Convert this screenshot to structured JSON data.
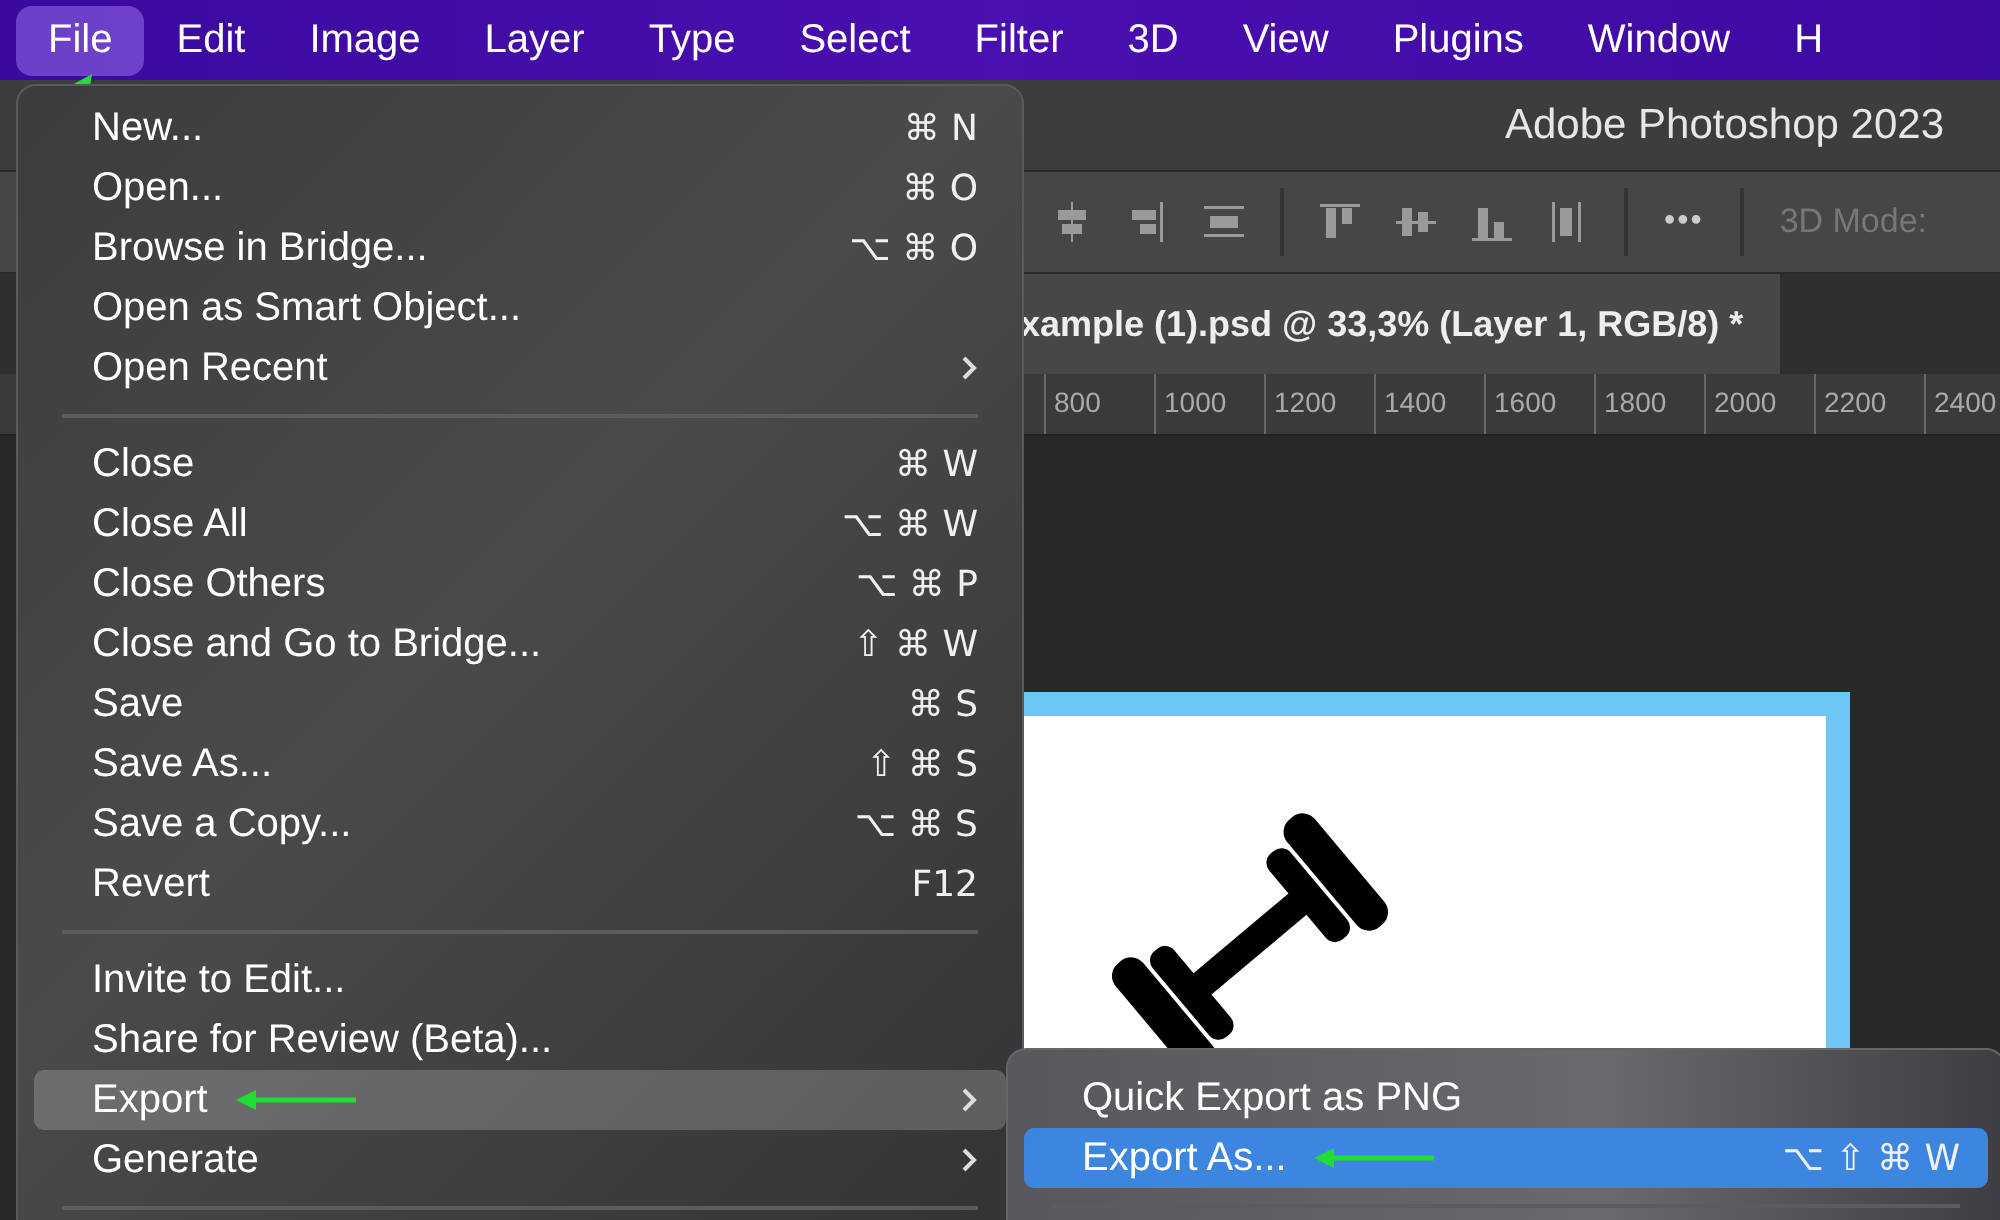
{
  "menubar": [
    {
      "label": "File",
      "selected": true
    },
    {
      "label": "Edit",
      "selected": false
    },
    {
      "label": "Image",
      "selected": false
    },
    {
      "label": "Layer",
      "selected": false
    },
    {
      "label": "Type",
      "selected": false
    },
    {
      "label": "Select",
      "selected": false
    },
    {
      "label": "Filter",
      "selected": false
    },
    {
      "label": "3D",
      "selected": false
    },
    {
      "label": "View",
      "selected": false
    },
    {
      "label": "Plugins",
      "selected": false
    },
    {
      "label": "Window",
      "selected": false
    },
    {
      "label": "H",
      "selected": false
    }
  ],
  "app": {
    "title": "Adobe Photoshop 2023",
    "options_more": "•••",
    "options_label": "3D Mode:",
    "document_tab": "xample (1).psd @ 33,3% (Layer 1, RGB/8) *",
    "ruler": [
      "800",
      "1000",
      "1200",
      "1400",
      "1600",
      "1800",
      "2000",
      "2200",
      "2400"
    ]
  },
  "file_menu": {
    "groups": [
      [
        {
          "label": "New...",
          "shortcut": "⌘ N",
          "selected": false
        },
        {
          "label": "Open...",
          "shortcut": "⌘ O",
          "selected": false
        },
        {
          "label": "Browse in Bridge...",
          "shortcut": "⌥ ⌘ O",
          "selected": false
        },
        {
          "label": "Open as Smart Object...",
          "selected": false
        },
        {
          "label": "Open Recent",
          "has_submenu": true,
          "selected": false
        }
      ],
      [
        {
          "label": "Close",
          "shortcut": "⌘ W",
          "selected": false
        },
        {
          "label": "Close All",
          "shortcut": "⌥ ⌘ W",
          "selected": false
        },
        {
          "label": "Close Others",
          "shortcut": "⌥ ⌘ P",
          "selected": false
        },
        {
          "label": "Close and Go to Bridge...",
          "shortcut": "⇧ ⌘ W",
          "selected": false
        },
        {
          "label": "Save",
          "shortcut": "⌘ S",
          "selected": false
        },
        {
          "label": "Save As...",
          "shortcut": "⇧ ⌘ S",
          "selected": false
        },
        {
          "label": "Save a Copy...",
          "shortcut": "⌥ ⌘ S",
          "selected": false
        },
        {
          "label": "Revert",
          "shortcut": "F12",
          "selected": false
        }
      ],
      [
        {
          "label": "Invite to Edit...",
          "selected": false
        },
        {
          "label": "Share for Review (Beta)...",
          "selected": false
        },
        {
          "label": "Export",
          "has_submenu": true,
          "selected": true,
          "pointer_arrow": true
        },
        {
          "label": "Generate",
          "has_submenu": true,
          "selected": false
        }
      ]
    ]
  },
  "export_submenu": {
    "items": [
      {
        "label": "Quick Export as PNG",
        "selected": false
      },
      {
        "label": "Export As...",
        "shortcut": "⌥ ⇧ ⌘ W",
        "selected": true,
        "pointer_arrow": true
      }
    ]
  }
}
